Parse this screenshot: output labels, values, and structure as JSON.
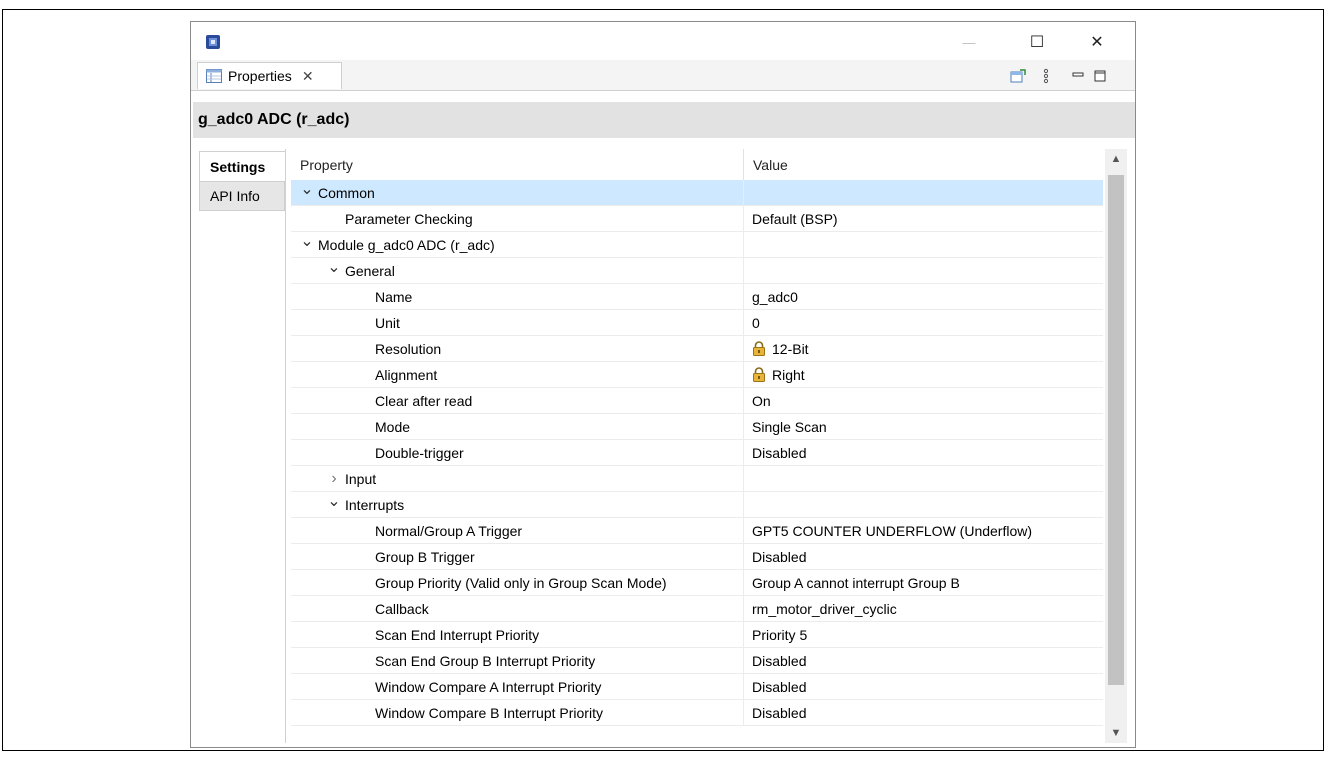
{
  "window": {
    "controls": {
      "minimize": "—",
      "maximize": "☐",
      "close": "✕"
    }
  },
  "tab": {
    "label": "Properties",
    "close_glyph": "✕"
  },
  "header": {
    "title": "g_adc0 ADC (r_adc)"
  },
  "side_tabs": [
    {
      "label": "Settings",
      "active": true
    },
    {
      "label": "API Info",
      "active": false
    }
  ],
  "grid": {
    "columns": {
      "property": "Property",
      "value": "Value"
    },
    "rows": [
      {
        "label": "Common",
        "value": "",
        "expand": "expanded",
        "level": 0,
        "selected": true
      },
      {
        "label": "Parameter Checking",
        "value": "Default (BSP)",
        "expand": "none",
        "level": 1
      },
      {
        "label": "Module g_adc0 ADC (r_adc)",
        "value": "",
        "expand": "expanded",
        "level": 0
      },
      {
        "label": "General",
        "value": "",
        "expand": "expanded",
        "level": 1
      },
      {
        "label": "Name",
        "value": "g_adc0",
        "expand": "none",
        "level": 2
      },
      {
        "label": "Unit",
        "value": "0",
        "expand": "none",
        "level": 2
      },
      {
        "label": "Resolution",
        "value": "12-Bit",
        "expand": "none",
        "level": 2,
        "locked": true
      },
      {
        "label": "Alignment",
        "value": "Right",
        "expand": "none",
        "level": 2,
        "locked": true
      },
      {
        "label": "Clear after read",
        "value": "On",
        "expand": "none",
        "level": 2
      },
      {
        "label": "Mode",
        "value": "Single Scan",
        "expand": "none",
        "level": 2
      },
      {
        "label": "Double-trigger",
        "value": "Disabled",
        "expand": "none",
        "level": 2
      },
      {
        "label": "Input",
        "value": "",
        "expand": "collapsed",
        "level": 1
      },
      {
        "label": "Interrupts",
        "value": "",
        "expand": "expanded",
        "level": 1
      },
      {
        "label": "Normal/Group A Trigger",
        "value": "GPT5 COUNTER UNDERFLOW (Underflow)",
        "expand": "none",
        "level": 2
      },
      {
        "label": "Group B Trigger",
        "value": "Disabled",
        "expand": "none",
        "level": 2
      },
      {
        "label": "Group Priority (Valid only in Group Scan Mode)",
        "value": "Group A cannot interrupt Group B",
        "expand": "none",
        "level": 2
      },
      {
        "label": "Callback",
        "value": "rm_motor_driver_cyclic",
        "expand": "none",
        "level": 2
      },
      {
        "label": "Scan End Interrupt Priority",
        "value": "Priority 5",
        "expand": "none",
        "level": 2
      },
      {
        "label": "Scan End Group B Interrupt Priority",
        "value": "Disabled",
        "expand": "none",
        "level": 2
      },
      {
        "label": "Window Compare A Interrupt Priority",
        "value": "Disabled",
        "expand": "none",
        "level": 2
      },
      {
        "label": "Window Compare B Interrupt Priority",
        "value": "Disabled",
        "expand": "none",
        "level": 2
      }
    ]
  },
  "icons": {
    "app": "app-chip-icon",
    "tab": "properties-table-icon",
    "toolbar": [
      "pin-view-icon",
      "view-menu-icon",
      "minimize-view-icon",
      "maximize-view-icon"
    ],
    "lock": "lock-icon"
  },
  "colors": {
    "selection": "#cde8ff",
    "header_strip": "#e2e2e2",
    "scroll_thumb": "#c2c2c2"
  }
}
